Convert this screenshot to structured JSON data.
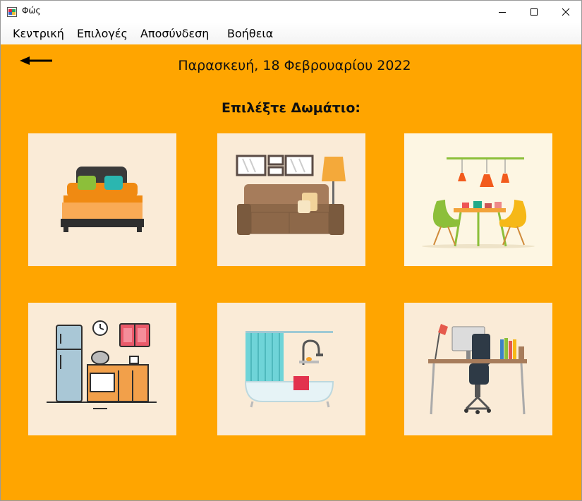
{
  "window": {
    "title": "Φώς",
    "icons": {
      "app": "app-window-icon",
      "minimize": "minimize-icon",
      "maximize": "maximize-icon",
      "close": "close-icon"
    }
  },
  "menu": {
    "items": [
      {
        "label": "Κεντρική"
      },
      {
        "label": "Επιλογές"
      },
      {
        "label": "Αποσύνδεση"
      },
      {
        "label": "Βοήθεια"
      }
    ]
  },
  "header": {
    "back_icon": "arrow-left-icon",
    "date": "Παρασκευή, 18 Φεβρουαρίου 2022",
    "prompt": "Επιλέξτε Δωμάτιο:"
  },
  "rooms": [
    {
      "room": "bedroom",
      "icon": "bed-icon"
    },
    {
      "room": "living-room",
      "icon": "sofa-icon"
    },
    {
      "room": "dining-room",
      "icon": "dining-table-icon"
    },
    {
      "room": "kitchen",
      "icon": "kitchen-icon"
    },
    {
      "room": "bathroom",
      "icon": "bathtub-icon"
    },
    {
      "room": "office",
      "icon": "desk-icon"
    }
  ],
  "colors": {
    "background": "#FFA500",
    "tile": "#FAEBD7",
    "text": "#111111"
  }
}
